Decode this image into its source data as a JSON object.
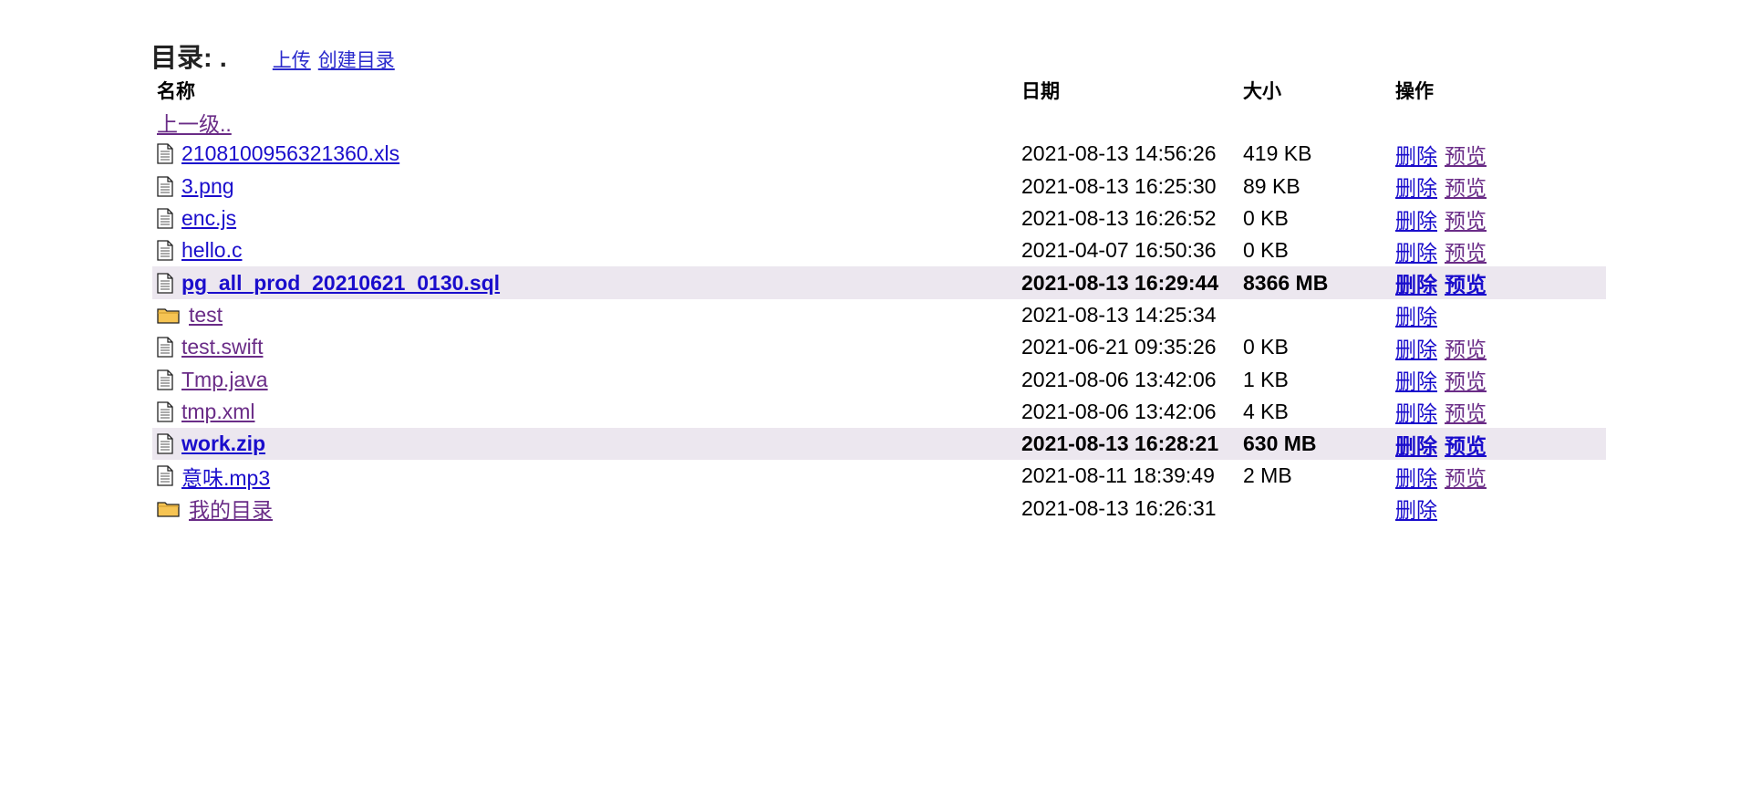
{
  "header": {
    "title": "目录: .",
    "upload_label": "上传",
    "mkdir_label": "创建目录"
  },
  "columns": {
    "name": "名称",
    "date": "日期",
    "size": "大小",
    "ops": "操作"
  },
  "parent_link": "上一级..",
  "actions": {
    "delete": "删除",
    "preview": "预览"
  },
  "files": [
    {
      "name": "2108100956321360.xls",
      "date": "2021-08-13 14:56:26",
      "size": "419 KB",
      "type": "file",
      "highlight": false,
      "visited": false
    },
    {
      "name": "3.png",
      "date": "2021-08-13 16:25:30",
      "size": "89 KB",
      "type": "file",
      "highlight": false,
      "visited": false
    },
    {
      "name": "enc.js",
      "date": "2021-08-13 16:26:52",
      "size": "0 KB",
      "type": "file",
      "highlight": false,
      "visited": false
    },
    {
      "name": "hello.c",
      "date": "2021-04-07 16:50:36",
      "size": "0 KB",
      "type": "file",
      "highlight": false,
      "visited": false
    },
    {
      "name": "pg_all_prod_20210621_0130.sql",
      "date": "2021-08-13 16:29:44",
      "size": "8366 MB",
      "type": "file",
      "highlight": true,
      "visited": false
    },
    {
      "name": "test",
      "date": "2021-08-13 14:25:34",
      "size": "",
      "type": "folder",
      "highlight": false,
      "visited": true
    },
    {
      "name": "test.swift",
      "date": "2021-06-21 09:35:26",
      "size": "0 KB",
      "type": "file",
      "highlight": false,
      "visited": true
    },
    {
      "name": "Tmp.java",
      "date": "2021-08-06 13:42:06",
      "size": "1 KB",
      "type": "file",
      "highlight": false,
      "visited": true
    },
    {
      "name": "tmp.xml",
      "date": "2021-08-06 13:42:06",
      "size": "4 KB",
      "type": "file",
      "highlight": false,
      "visited": true
    },
    {
      "name": "work.zip",
      "date": "2021-08-13 16:28:21",
      "size": "630 MB",
      "type": "file",
      "highlight": true,
      "visited": false
    },
    {
      "name": "意味.mp3",
      "date": "2021-08-11 18:39:49",
      "size": "2 MB",
      "type": "file",
      "highlight": false,
      "visited": false
    },
    {
      "name": "我的目录",
      "date": "2021-08-13 16:26:31",
      "size": "",
      "type": "folder",
      "highlight": false,
      "visited": true
    }
  ],
  "colors": {
    "link": "#1a0dcc",
    "visited": "#6a2c87",
    "highlight_row": "#ece7ef"
  }
}
